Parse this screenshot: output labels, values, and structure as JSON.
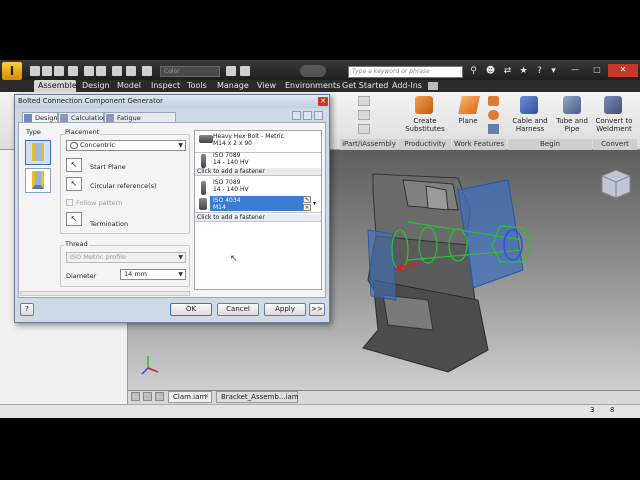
{
  "app": {
    "search_placeholder": "Type a keyword or phrase",
    "color_combo": "Color"
  },
  "ribbon_tabs": [
    "Assemble",
    "Design",
    "Model",
    "Inspect",
    "Tools",
    "Manage",
    "View",
    "Environments",
    "Get Started",
    "Add-Ins"
  ],
  "ribbon": {
    "productivity": {
      "button": "Create\nSubstitutes",
      "label": "Productivity"
    },
    "iassembly": {
      "label": "iPart/iAssembly"
    },
    "work_features": {
      "button": "Plane",
      "label": "Work Features"
    },
    "begin": {
      "buttons": [
        "Cable and\nHarness",
        "Tube and\nPipe"
      ],
      "label": "Begin"
    },
    "convert": {
      "button": "Convert to\nWeldment",
      "label": "Convert"
    }
  },
  "dialog": {
    "title": "Bolted Connection Component Generator",
    "tabs": [
      "Design",
      "Calculation",
      "Fatigue Calculation"
    ],
    "type_label": "Type",
    "placement_label": "Placement",
    "placement_option": "Concentric",
    "start_plane": "Start Plane",
    "circular_reference": "Circular reference(s)",
    "follow_pattern": "Follow pattern",
    "termination": "Termination",
    "thread_label": "Thread",
    "thread_value": "ISO Metric profile",
    "diameter_label": "Diameter",
    "diameter_value": "14 mm",
    "fasteners": [
      {
        "name": "Heavy Hex Bolt - Metric",
        "spec": "M14 x 2 x 90"
      },
      {
        "name": "ISO 7089",
        "spec": "14 - 140 HV"
      },
      {
        "name": "ISO 7089",
        "spec": "14 - 140 HV"
      },
      {
        "name": "ISO 4034",
        "spec": "M14"
      }
    ],
    "click_to_add": "Click to add a fastener",
    "buttons": {
      "ok": "OK",
      "cancel": "Cancel",
      "apply": "Apply",
      "more": ">>"
    }
  },
  "document_tabs": [
    "Clam.iam",
    "Bracket_Assemb...iam"
  ],
  "status": {
    "count1": "3",
    "count2": "8"
  },
  "colors": {
    "selection_blue": "#3a7bd5",
    "highlight_green": "#34c734",
    "close_red": "#c6382a"
  }
}
